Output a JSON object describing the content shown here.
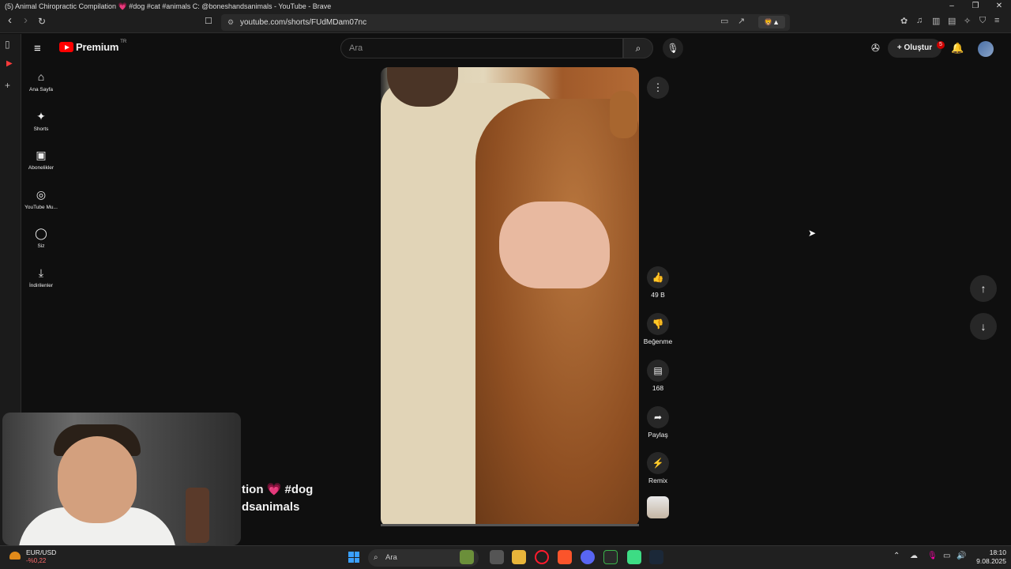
{
  "window": {
    "title": "(5) Animal Chiropractic Compilation 💗 #dog #cat #animals C: @boneshandsanimals - YouTube - Brave",
    "controls": [
      "–",
      "❐",
      "✕"
    ]
  },
  "browser": {
    "url": "youtube.com/shorts/FUdMDam07nc",
    "back": "‹",
    "forward": "›",
    "reload": "↻",
    "bookmark": "☐"
  },
  "youtube": {
    "logo_text": "Premium",
    "country": "TR",
    "search_placeholder": "Ara",
    "create_label": "Oluştur",
    "notification_count": "5"
  },
  "left_nav": [
    {
      "icon": "home-icon",
      "glyph": "⌂",
      "label": "Ana Sayfa"
    },
    {
      "icon": "shorts-icon",
      "glyph": "✦",
      "label": "Shorts"
    },
    {
      "icon": "subscriptions-icon",
      "glyph": "▣",
      "label": "Abonelikler"
    },
    {
      "icon": "youtube-music-icon",
      "glyph": "◎",
      "label": "YouTube Mu..."
    },
    {
      "icon": "you-icon",
      "glyph": "◯",
      "label": "Siz"
    },
    {
      "icon": "downloads-icon",
      "glyph": "⤓",
      "label": "İndirilenler"
    }
  ],
  "short": {
    "title_line1": "tion 💗 #dog",
    "title_line2": "dsanimals",
    "progress": 0.0,
    "actions": {
      "like": "49 B",
      "dislike": "Beğenme",
      "comments": "168",
      "share": "Paylaş",
      "remix": "Remix"
    }
  },
  "taskbar": {
    "ticker": "EUR/USD",
    "ticker_change": "-%0,22",
    "search_placeholder": "Ara",
    "time": "18:10",
    "date": "9.08.2025"
  },
  "colors": {
    "brand_red": "#ff0000",
    "background": "#0f0f0f",
    "badge_red": "#cc0000"
  }
}
